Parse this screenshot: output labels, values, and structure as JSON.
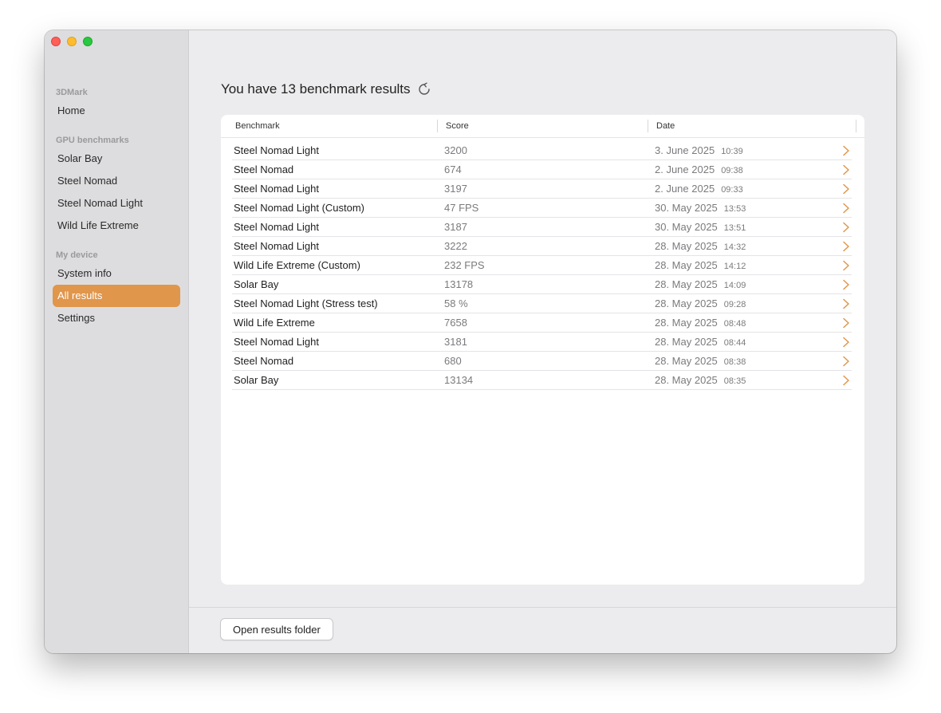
{
  "sidebar": {
    "sections": [
      {
        "title": "3DMark",
        "items": [
          "Home"
        ]
      },
      {
        "title": "GPU benchmarks",
        "items": [
          "Solar Bay",
          "Steel Nomad",
          "Steel Nomad Light",
          "Wild Life Extreme"
        ]
      },
      {
        "title": "My device",
        "items": [
          "System info",
          "All results",
          "Settings"
        ]
      }
    ],
    "active_item": "All results"
  },
  "main": {
    "heading": "You have 13 benchmark results",
    "table": {
      "columns": [
        "Benchmark",
        "Score",
        "Date"
      ],
      "rows": [
        {
          "benchmark": "Steel Nomad Light",
          "score": "3200",
          "date": "3. June 2025",
          "time": "10:39"
        },
        {
          "benchmark": "Steel Nomad",
          "score": "674",
          "date": "2. June 2025",
          "time": "09:38"
        },
        {
          "benchmark": "Steel Nomad Light",
          "score": "3197",
          "date": "2. June 2025",
          "time": "09:33"
        },
        {
          "benchmark": "Steel Nomad Light (Custom)",
          "score": "47 FPS",
          "date": "30. May 2025",
          "time": "13:53"
        },
        {
          "benchmark": "Steel Nomad Light",
          "score": "3187",
          "date": "30. May 2025",
          "time": "13:51"
        },
        {
          "benchmark": "Steel Nomad Light",
          "score": "3222",
          "date": "28. May 2025",
          "time": "14:32"
        },
        {
          "benchmark": "Wild Life Extreme (Custom)",
          "score": "232 FPS",
          "date": "28. May 2025",
          "time": "14:12"
        },
        {
          "benchmark": "Solar Bay",
          "score": "13178",
          "date": "28. May 2025",
          "time": "14:09"
        },
        {
          "benchmark": "Steel Nomad Light (Stress test)",
          "score": "58 %",
          "date": "28. May 2025",
          "time": "09:28"
        },
        {
          "benchmark": "Wild Life Extreme",
          "score": "7658",
          "date": "28. May 2025",
          "time": "08:48"
        },
        {
          "benchmark": "Steel Nomad Light",
          "score": "3181",
          "date": "28. May 2025",
          "time": "08:44"
        },
        {
          "benchmark": "Steel Nomad",
          "score": "680",
          "date": "28. May 2025",
          "time": "08:38"
        },
        {
          "benchmark": "Solar Bay",
          "score": "13134",
          "date": "28. May 2025",
          "time": "08:35"
        }
      ]
    },
    "open_folder_label": "Open results folder"
  },
  "icons": {
    "refresh": "refresh-icon",
    "row_chevron": "chevron-right-icon"
  },
  "colors": {
    "accent": "#e0964b",
    "close": "#fe5f57",
    "minimize": "#febc2e",
    "zoom": "#28c840"
  }
}
